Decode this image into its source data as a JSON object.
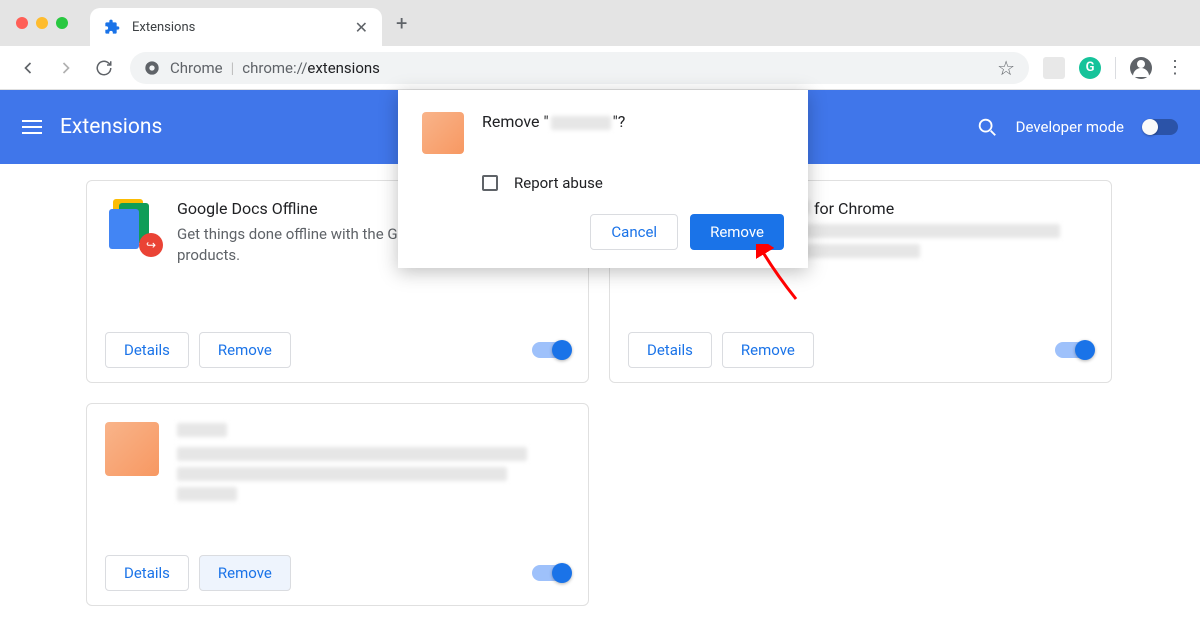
{
  "window": {
    "tab_title": "Extensions"
  },
  "toolbar": {
    "url_scheme": "Chrome",
    "url_path": "chrome://",
    "url_strong": "extensions",
    "grammarly_letter": "G"
  },
  "header": {
    "title": "Extensions",
    "dev_mode_label": "Developer mode"
  },
  "cards": [
    {
      "title": "Google Docs Offline",
      "desc": "Get things done offline with the Google Docs family of products.",
      "details": "Details",
      "remove": "Remove"
    },
    {
      "title_suffix": " for Chrome",
      "details": "Details",
      "remove": "Remove"
    },
    {
      "details": "Details",
      "remove": "Remove"
    }
  ],
  "dialog": {
    "prefix": "Remove \"",
    "suffix": "\"?",
    "report_abuse": "Report abuse",
    "cancel": "Cancel",
    "confirm": "Remove"
  }
}
